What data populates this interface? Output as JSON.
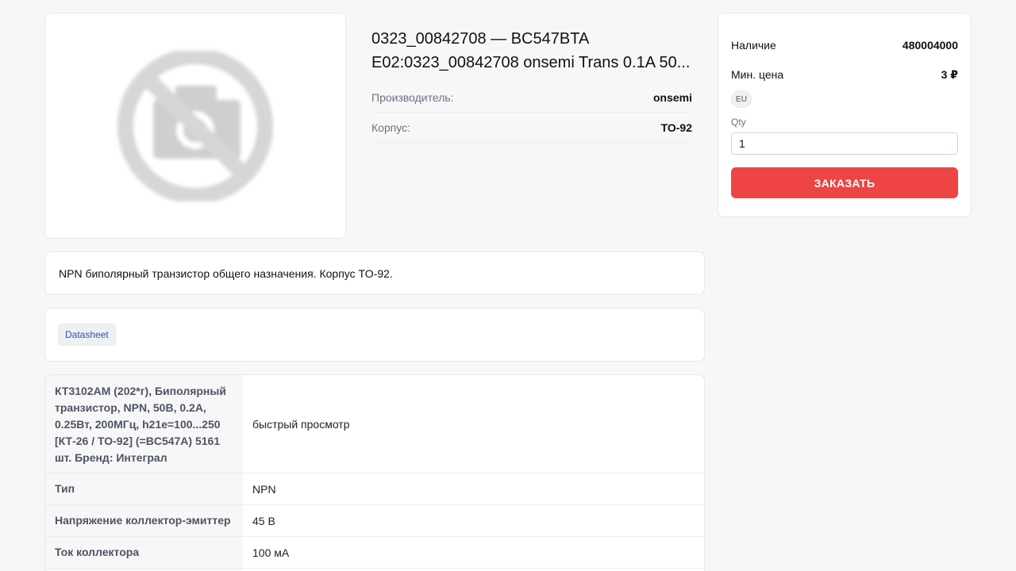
{
  "product": {
    "title_line1": "0323_00842708 — BC547BTA",
    "title_line2": "E02:0323_00842708 onsemi Trans 0.1A 50...",
    "specs": [
      {
        "label": "Производитель:",
        "value": "onsemi"
      },
      {
        "label": "Корпус:",
        "value": "TO-92"
      }
    ],
    "image_icon": "no-photo-icon"
  },
  "buy": {
    "stock_label": "Наличие",
    "stock_value": "480004000",
    "min_price_label": "Мин. цена",
    "min_price_value": "3 ₽",
    "region_badge": "EU",
    "qty_label": "Qty",
    "qty_value": "1",
    "order_button": "ЗАКАЗАТЬ",
    "accent_color": "#ef4444"
  },
  "description": "NPN биполярный транзистор общего назначения. Корпус TO-92.",
  "links": {
    "datasheet": "Datasheet"
  },
  "params": [
    {
      "name": "КТ3102АМ (202*г), Биполярный транзистор, NPN, 50В, 0.2А, 0.25Вт, 200МГц, h21e=100...250 [КТ-26 / ТО-92] (=BC547A) 5161 шт. Бренд: Интеграл",
      "value": "быстрый просмотр"
    },
    {
      "name": "Тип",
      "value": "NPN"
    },
    {
      "name": "Напряжение коллектор-эмиттер",
      "value": "45 В"
    },
    {
      "name": "Ток коллектора",
      "value": "100 мА"
    },
    {
      "name": "",
      "value": ""
    }
  ]
}
